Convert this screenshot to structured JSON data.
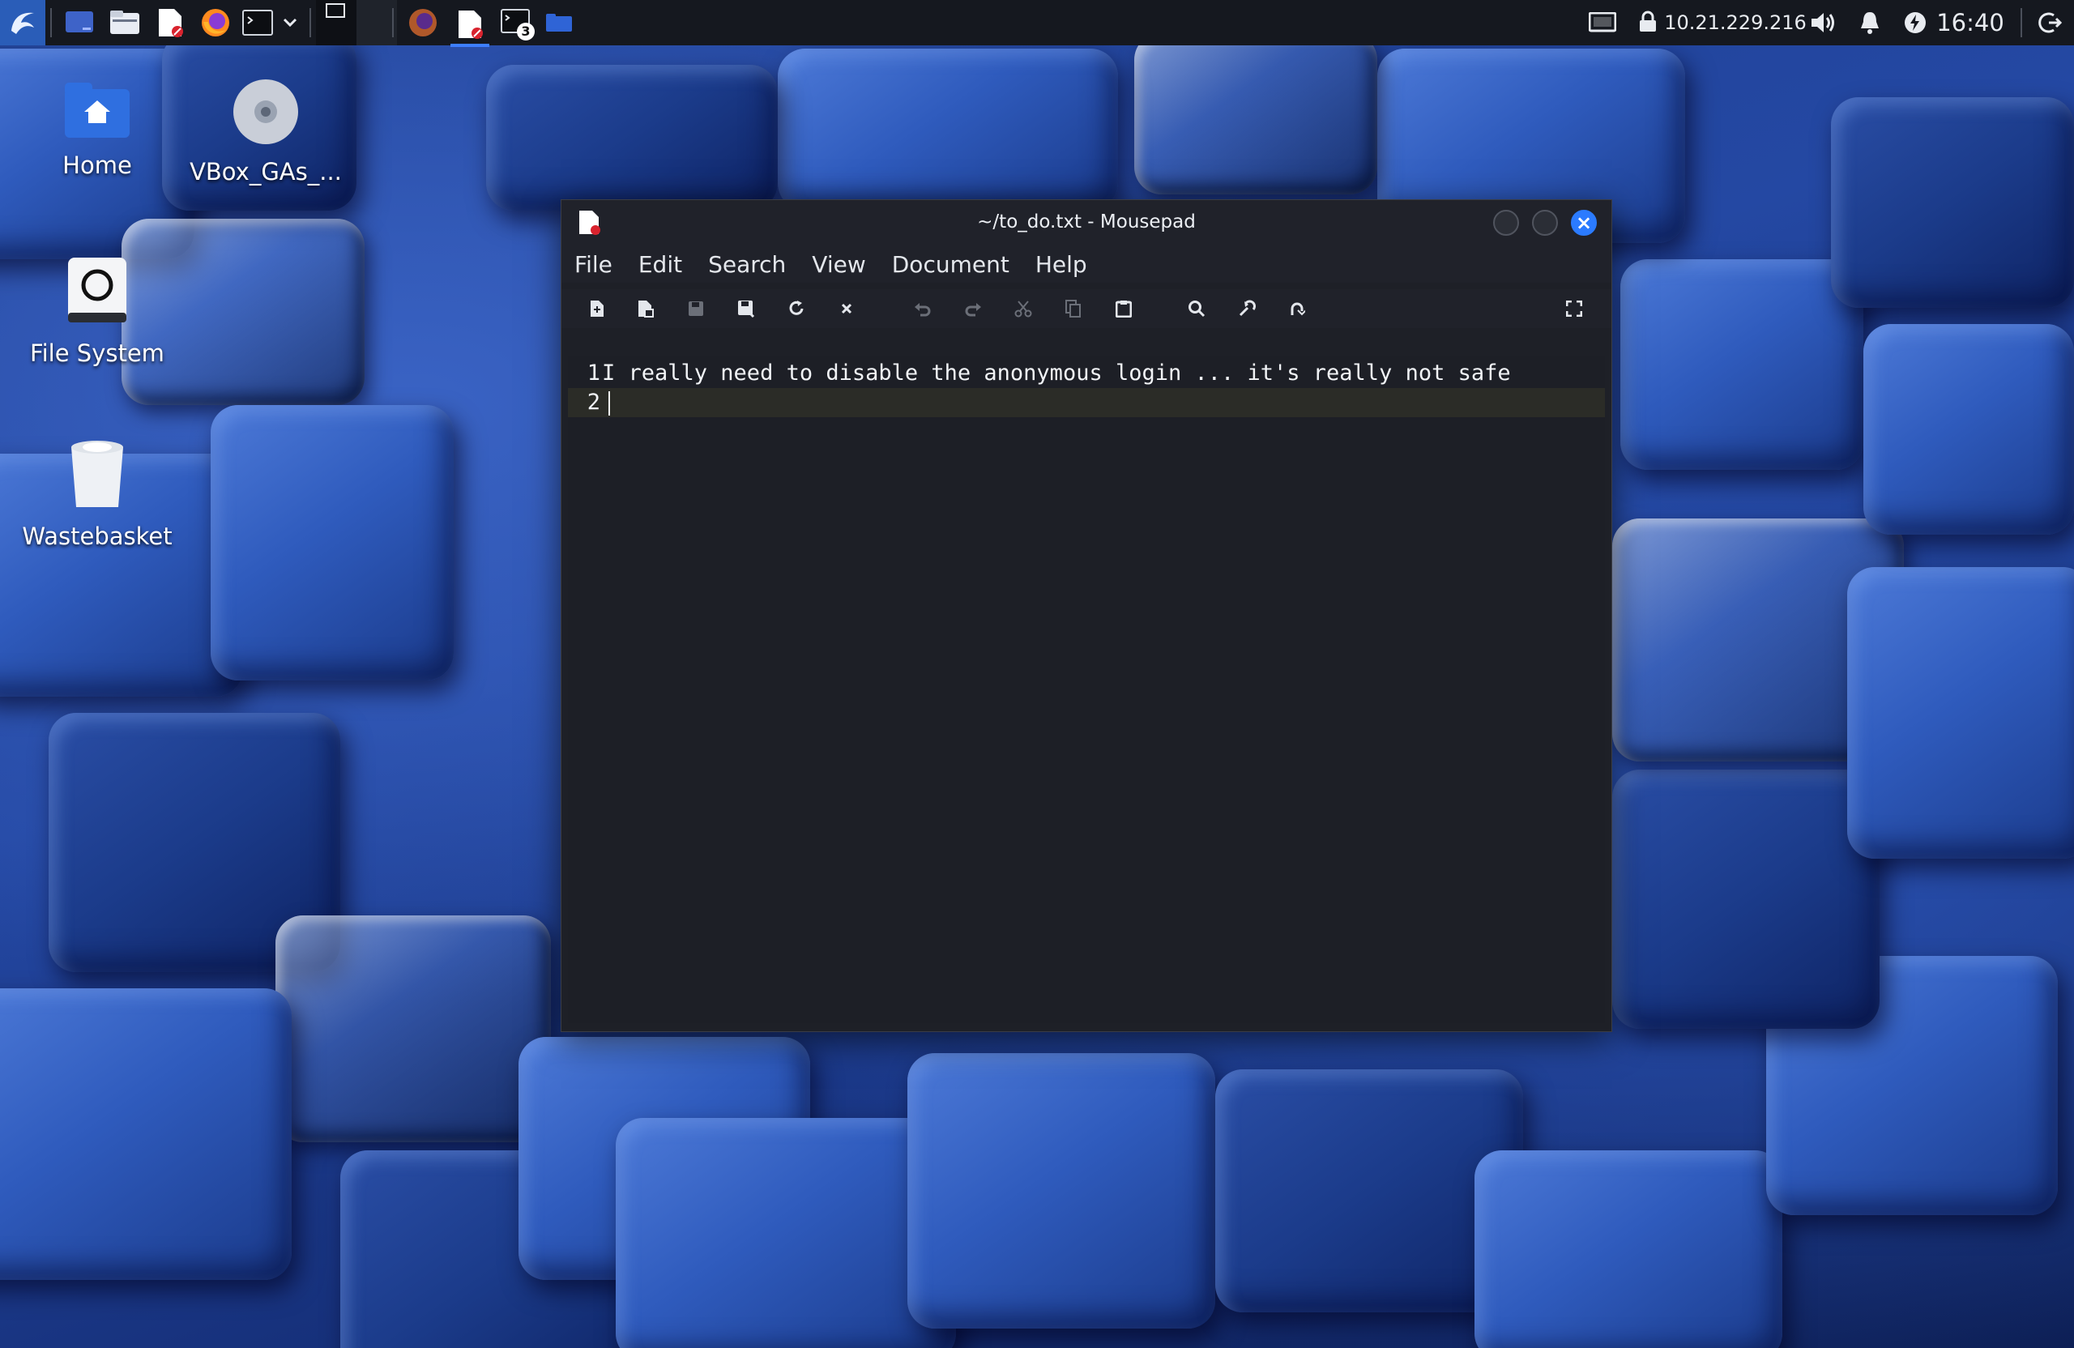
{
  "panel": {
    "ip": "10.21.229.216",
    "time": "16:40",
    "badge_count": "3"
  },
  "desktop": {
    "icons": [
      {
        "label": "Home"
      },
      {
        "label": "VBox_GAs_..."
      },
      {
        "label": "File System"
      },
      {
        "label": "Wastebasket"
      }
    ]
  },
  "window": {
    "title": "~/to_do.txt - Mousepad",
    "menu": [
      "File",
      "Edit",
      "Search",
      "View",
      "Document",
      "Help"
    ],
    "editor": {
      "lines": [
        {
          "number": "1",
          "text": "I really need to disable the anonymous login ... it's really not safe"
        },
        {
          "number": "2",
          "text": ""
        }
      ]
    }
  },
  "colors": {
    "accent": "#2b7bff",
    "panel_bg": "#15181f",
    "window_bg": "#1e2027"
  }
}
